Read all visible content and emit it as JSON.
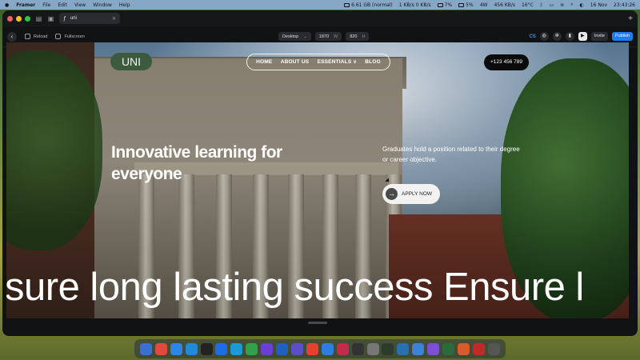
{
  "menubar": {
    "app": "Framer",
    "menus": [
      "File",
      "Edit",
      "View",
      "Window",
      "Help"
    ],
    "status": {
      "memory": "6.61 GB (normal)",
      "net_up": "1 KB/s",
      "net_down": "0 KB/s",
      "cpu": "7%",
      "gpu": "5%",
      "power": "4W",
      "io": "456 KB/s",
      "temp": "16°C",
      "date": "16 Nov",
      "time": "23:43:26"
    }
  },
  "tab": {
    "title": "uni"
  },
  "toolbar": {
    "reload": "Reload",
    "fullscreen": "Fullscreen",
    "device": "Desktop",
    "width": "1870",
    "width_unit": "W",
    "height": "820",
    "height_unit": "H",
    "avatar": "CS",
    "invite": "Invite",
    "publish": "Publish"
  },
  "site": {
    "logo": "UNI",
    "nav": {
      "home": "HOME",
      "about": "ABOUT US",
      "essentials": "ESSENTIALS",
      "blog": "BLOG"
    },
    "phone": "+123 456 789",
    "hero_title": "Innovative learning for everyone",
    "hero_sub": "Graduates hold a position related to their degree or career objective.",
    "cta": "APPLY NOW",
    "marquee": "sure long lasting success Ensure l"
  },
  "colors": {
    "accent": "#1f7cf5",
    "logo_bg": "#3b5a3e",
    "window_bg": "#111214"
  }
}
